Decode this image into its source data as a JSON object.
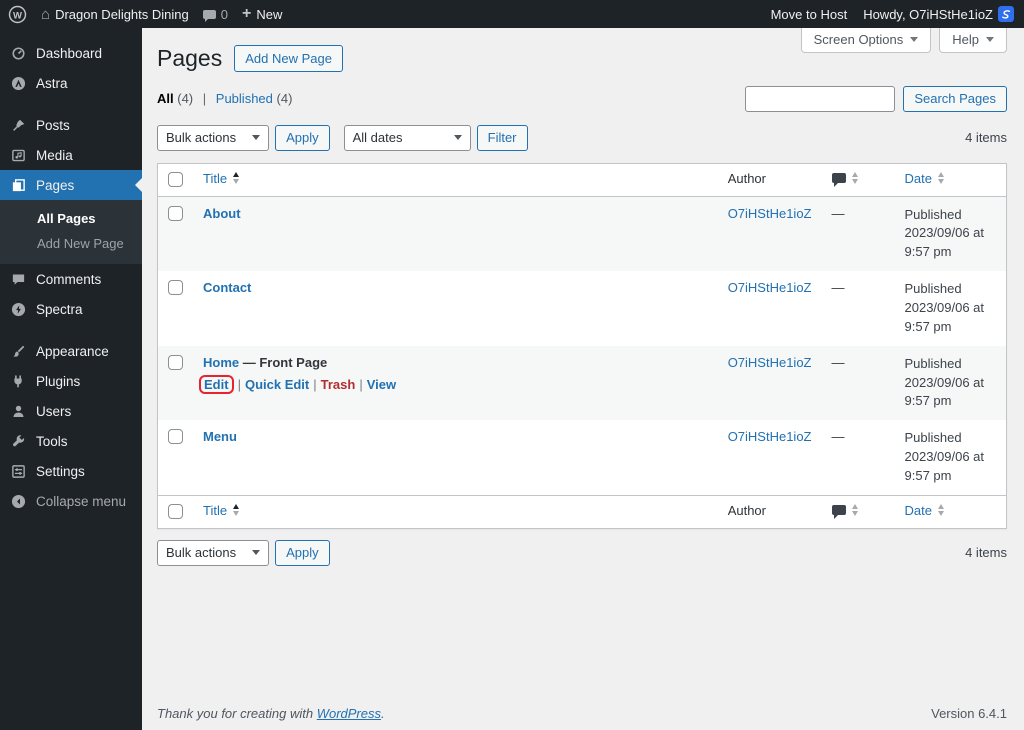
{
  "admin_bar": {
    "site_name": "Dragon Delights Dining",
    "comments_count": "0",
    "new_label": "New",
    "move_to_host": "Move to Host",
    "howdy": "Howdy, O7iHStHe1ioZ"
  },
  "sidebar": {
    "items": [
      {
        "label": "Dashboard"
      },
      {
        "label": "Astra"
      },
      {
        "label": "Posts"
      },
      {
        "label": "Media"
      },
      {
        "label": "Pages"
      },
      {
        "label": "Comments"
      },
      {
        "label": "Spectra"
      },
      {
        "label": "Appearance"
      },
      {
        "label": "Plugins"
      },
      {
        "label": "Users"
      },
      {
        "label": "Tools"
      },
      {
        "label": "Settings"
      },
      {
        "label": "Collapse menu"
      }
    ],
    "submenu": [
      {
        "label": "All Pages"
      },
      {
        "label": "Add New Page"
      }
    ]
  },
  "screen_meta": {
    "screen_options": "Screen Options",
    "help": "Help"
  },
  "header": {
    "title": "Pages",
    "add_new": "Add New Page"
  },
  "search": {
    "button": "Search Pages",
    "value": ""
  },
  "views": {
    "all": "All",
    "all_count": "(4)",
    "sep": "|",
    "published": "Published",
    "published_count": "(4)"
  },
  "filters": {
    "bulk_actions": "Bulk actions",
    "apply": "Apply",
    "all_dates": "All dates",
    "filter": "Filter"
  },
  "list": {
    "items_count": "4 items",
    "columns": {
      "title": "Title",
      "author": "Author",
      "date": "Date"
    },
    "rows": [
      {
        "title": "About",
        "suffix": "",
        "author": "O7iHStHe1ioZ",
        "comments": "—",
        "status": "Published",
        "date": "2023/09/06 at",
        "time": "9:57 pm"
      },
      {
        "title": "Contact",
        "suffix": "",
        "author": "O7iHStHe1ioZ",
        "comments": "—",
        "status": "Published",
        "date": "2023/09/06 at",
        "time": "9:57 pm"
      },
      {
        "title": "Home",
        "suffix": "— Front Page",
        "author": "O7iHStHe1ioZ",
        "comments": "—",
        "status": "Published",
        "date": "2023/09/06 at",
        "time": "9:57 pm"
      },
      {
        "title": "Menu",
        "suffix": "",
        "author": "O7iHStHe1ioZ",
        "comments": "—",
        "status": "Published",
        "date": "2023/09/06 at",
        "time": "9:57 pm"
      }
    ],
    "row_actions": {
      "edit": "Edit",
      "quick_edit": "Quick Edit",
      "trash": "Trash",
      "view": "View",
      "sep": "|"
    }
  },
  "footer": {
    "thanks": "Thank you for creating with",
    "wordpress": "WordPress",
    "period": ".",
    "version": "Version 6.4.1"
  }
}
